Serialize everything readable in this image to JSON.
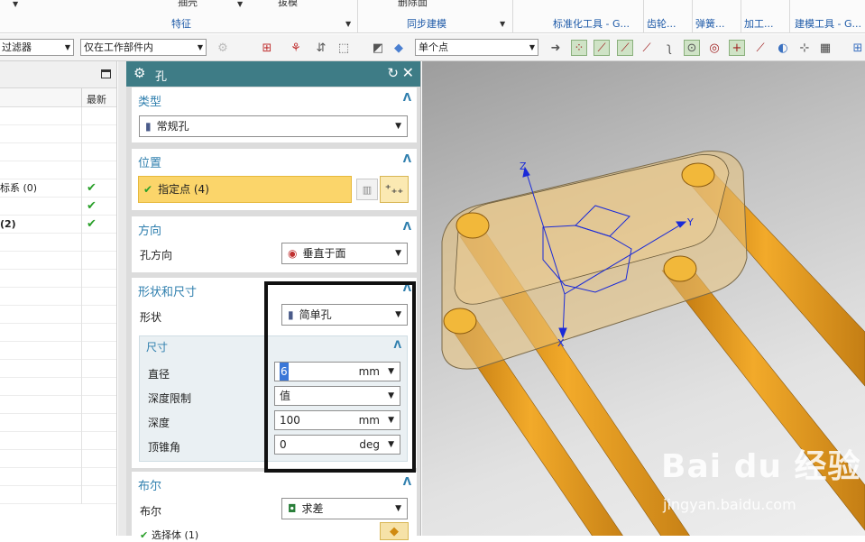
{
  "ribbon": {
    "groups": [
      {
        "label": "特征",
        "top": "抽壳"
      },
      {
        "label": "同步建模",
        "top": "删除面"
      },
      {
        "label": "标准化工具 - G...",
        "top": ""
      },
      {
        "label": "齿轮...",
        "top": ""
      },
      {
        "label": "弹簧...",
        "top": ""
      },
      {
        "label": "加工...",
        "top": ""
      },
      {
        "label": "建模工具 - G...",
        "top": ""
      }
    ],
    "extra_top": "拔模"
  },
  "toolbar": {
    "filter": "过滤器",
    "scope": "仅在工作部件内",
    "snap": "单个点"
  },
  "navigator": {
    "col_latest": "最新",
    "rows": [
      {
        "text": "",
        "check": false
      },
      {
        "text": "",
        "check": false
      },
      {
        "text": "",
        "check": false
      },
      {
        "text": "",
        "check": false
      },
      {
        "text": "标系 (0)",
        "check": true
      },
      {
        "text": "",
        "check": true
      },
      {
        "text": "(2)",
        "check": true
      },
      {
        "text": "",
        "check": false
      },
      {
        "text": "",
        "check": false
      },
      {
        "text": "",
        "check": false
      },
      {
        "text": "",
        "check": false
      },
      {
        "text": "",
        "check": false
      },
      {
        "text": "",
        "check": false
      },
      {
        "text": "",
        "check": false
      },
      {
        "text": "",
        "check": false
      },
      {
        "text": "",
        "check": false
      },
      {
        "text": "",
        "check": false
      },
      {
        "text": "",
        "check": false
      },
      {
        "text": "",
        "check": false
      },
      {
        "text": "",
        "check": false
      },
      {
        "text": "",
        "check": false
      },
      {
        "text": "",
        "check": false
      }
    ]
  },
  "dialog": {
    "title": "孔",
    "type": {
      "header": "类型",
      "value": "常规孔"
    },
    "position": {
      "header": "位置",
      "selection": "指定点 (4)"
    },
    "direction": {
      "header": "方向",
      "label": "孔方向",
      "value": "垂直于面"
    },
    "shape": {
      "header": "形状和尺寸",
      "shape_label": "形状",
      "shape_value": "简单孔",
      "dims_header": "尺寸",
      "diameter_label": "直径",
      "diameter_value": "6",
      "diameter_unit": "mm",
      "depth_limit_label": "深度限制",
      "depth_limit_value": "值",
      "depth_label": "深度",
      "depth_value": "100",
      "depth_unit": "mm",
      "tip_label": "顶锥角",
      "tip_value": "0",
      "tip_unit": "deg"
    },
    "boolean": {
      "header": "布尔",
      "label": "布尔",
      "value": "求差",
      "body": "选择体 (1)"
    }
  },
  "viewport": {
    "axis_x": "X",
    "axis_y": "Y",
    "axis_z": "Z",
    "watermark_big": "Bai du 经验",
    "watermark_sub": "jingyan.baidu.com",
    "colors": {
      "rod": "#e8a020",
      "plate": "#e9c27a",
      "triad": "#1a2ad8"
    }
  }
}
